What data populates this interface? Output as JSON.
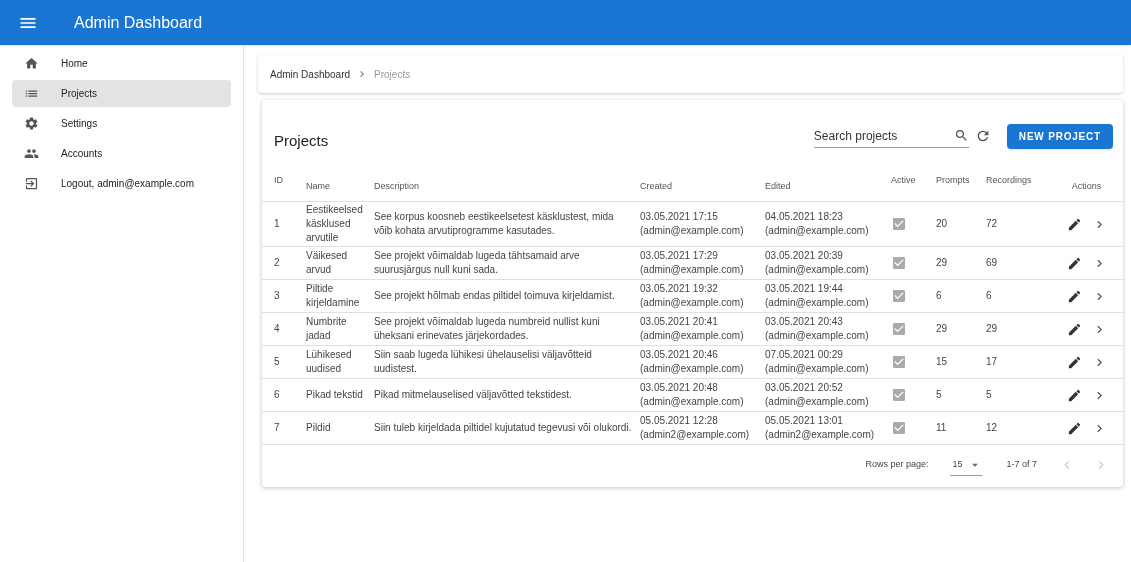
{
  "app_bar": {
    "title": "Admin Dashboard"
  },
  "sidebar": {
    "items": [
      {
        "label": "Home",
        "selected": false
      },
      {
        "label": "Projects",
        "selected": true
      },
      {
        "label": "Settings",
        "selected": false
      },
      {
        "label": "Accounts",
        "selected": false
      },
      {
        "label": "Logout, admin@example.com",
        "selected": false
      }
    ]
  },
  "breadcrumb": [
    "Admin Dashboard",
    "Projects"
  ],
  "projects": {
    "title": "Projects",
    "search": {
      "placeholder": "Search projects"
    },
    "new_button": "NEW PROJECT",
    "table": {
      "columns": [
        "ID",
        "Name",
        "Description",
        "Created",
        "Edited",
        "Active",
        "Prompts",
        "Recordings",
        "Actions"
      ],
      "rows": [
        {
          "id": "1",
          "name": "Eestikeelsed käsklused arvutile",
          "description": "See korpus koosneb eestikeelsetest käsklustest, mida võib kohata arvutiprogramme kasutades.",
          "created": [
            "03.05.2021 17:15",
            "(admin@example.com)"
          ],
          "edited": [
            "04.05.2021 18:23",
            "(admin@example.com)"
          ],
          "active": true,
          "prompts": "20",
          "recordings": "72"
        },
        {
          "id": "2",
          "name": "Väikesed arvud",
          "description": "See projekt võimaldab lugeda tähtsamaid arve suurusjärgus null kuni sada.",
          "created": [
            "03.05.2021 17:29",
            "(admin@example.com)"
          ],
          "edited": [
            "03.05.2021 20:39",
            "(admin@example.com)"
          ],
          "active": true,
          "prompts": "29",
          "recordings": "69"
        },
        {
          "id": "3",
          "name": "Piltide kirjeldamine",
          "description": "See projekt hõlmab endas piltidel toimuva kirjeldamist.",
          "created": [
            "03.05.2021 19:32",
            "(admin@example.com)"
          ],
          "edited": [
            "03.05.2021 19:44",
            "(admin@example.com)"
          ],
          "active": true,
          "prompts": "6",
          "recordings": "6"
        },
        {
          "id": "4",
          "name": "Numbrite jadad",
          "description": "See projekt võimaldab lugeda numbreid nullist kuni üheksani erinevates järjekordades.",
          "created": [
            "03.05.2021 20:41",
            "(admin@example.com)"
          ],
          "edited": [
            "03.05.2021 20:43",
            "(admin@example.com)"
          ],
          "active": true,
          "prompts": "29",
          "recordings": "29"
        },
        {
          "id": "5",
          "name": "Lühikesed uudised",
          "description": "Siin saab lugeda lühikesi ühelauselisi väljavõtteid uudistest.",
          "created": [
            "03.05.2021 20:46",
            "(admin@example.com)"
          ],
          "edited": [
            "07.05.2021 00:29",
            "(admin@example.com)"
          ],
          "active": true,
          "prompts": "15",
          "recordings": "17"
        },
        {
          "id": "6",
          "name": "Pikad tekstid",
          "description": "Pikad mitmelauselised väljavõtted tekstidest.",
          "created": [
            "03.05.2021 20:48",
            "(admin@example.com)"
          ],
          "edited": [
            "03.05.2021 20:52",
            "(admin@example.com)"
          ],
          "active": true,
          "prompts": "5",
          "recordings": "5"
        },
        {
          "id": "7",
          "name": "Pildid",
          "description": "Siin tuleb kirjeldada piltidel kujutatud tegevusi või olukordi.",
          "created": [
            "05.05.2021 12:28",
            "(admin2@example.com)"
          ],
          "edited": [
            "05.05.2021 13:01",
            "(admin2@example.com)"
          ],
          "active": true,
          "prompts": "11",
          "recordings": "12"
        }
      ]
    },
    "pagination": {
      "rows_per_page_label": "Rows per page:",
      "rows_per_page": "15",
      "range": "1-7 of 7",
      "prev_disabled": true,
      "next_disabled": true
    }
  }
}
